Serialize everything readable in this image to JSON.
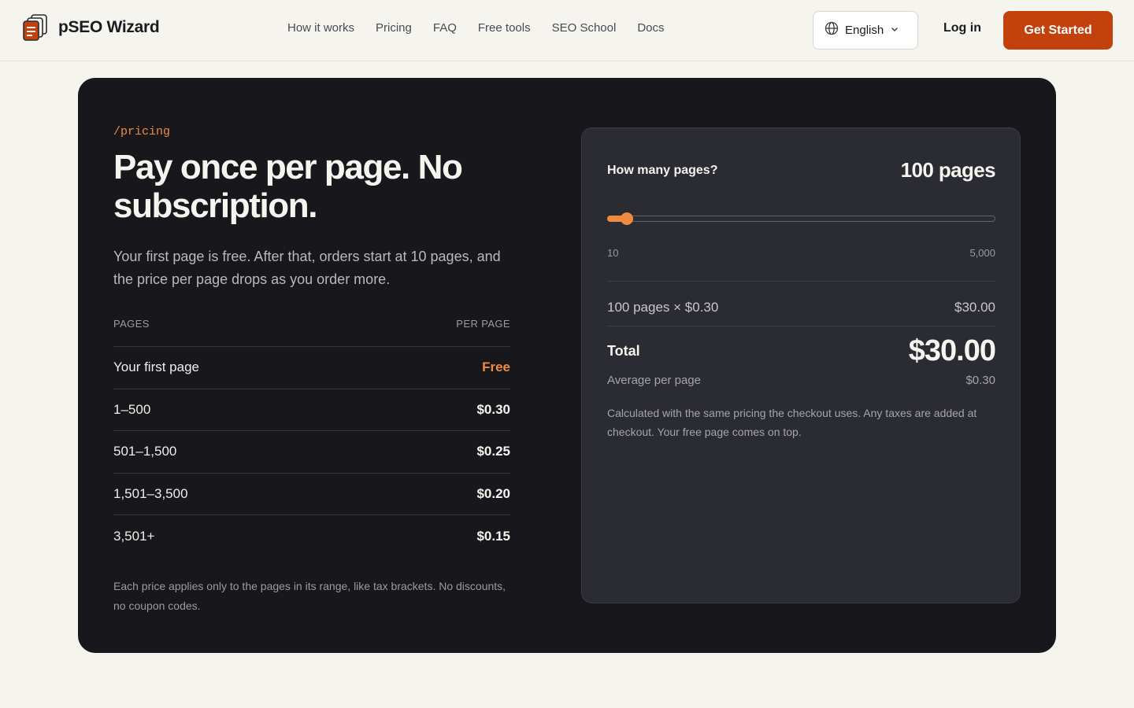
{
  "brand": {
    "name": "pSEO Wizard"
  },
  "nav": [
    {
      "label": "How it works"
    },
    {
      "label": "Pricing"
    },
    {
      "label": "FAQ"
    },
    {
      "label": "Free tools"
    },
    {
      "label": "SEO School"
    },
    {
      "label": "Docs"
    }
  ],
  "header": {
    "language": "English",
    "login_label": "Log in",
    "cta_label": "Get Started"
  },
  "colors": {
    "accent": "#c2410c",
    "accent_light": "#f08a3e",
    "card_bg": "#18181c",
    "panel_bg": "#2a2b33",
    "page_bg": "#f5f4ef"
  },
  "pricing": {
    "eyebrow": "/pricing",
    "headline": "Pay once per page. No subscription.",
    "lead": "Your first page is free. After that, orders start at 10 pages, and the price per page drops as you order more.",
    "table_headers": {
      "pages": "PAGES",
      "per_page": "PER PAGE"
    },
    "tiers": [
      {
        "range": "Your first page",
        "price": "Free"
      },
      {
        "range": "1–500",
        "price": "$0.30"
      },
      {
        "range": "501–1,500",
        "price": "$0.25"
      },
      {
        "range": "1,501–3,500",
        "price": "$0.20"
      },
      {
        "range": "3,501+",
        "price": "$0.15"
      }
    ],
    "footnote": "Each price applies only to the pages in its range, like tax brackets. No discounts, no coupon codes."
  },
  "calculator": {
    "question": "How many pages?",
    "value_display": "100 pages",
    "slider": {
      "min": 10,
      "max": 5000,
      "value": 100,
      "min_label": "10",
      "max_label": "5,000"
    },
    "line_label": "100 pages × $0.30",
    "line_amount": "$30.00",
    "total_label": "Total",
    "total_value": "$30.00",
    "avg_label": "Average per page",
    "avg_value": "$0.30",
    "note": "Calculated with the same pricing the checkout uses. Any taxes are added at checkout. Your free page comes on top."
  }
}
